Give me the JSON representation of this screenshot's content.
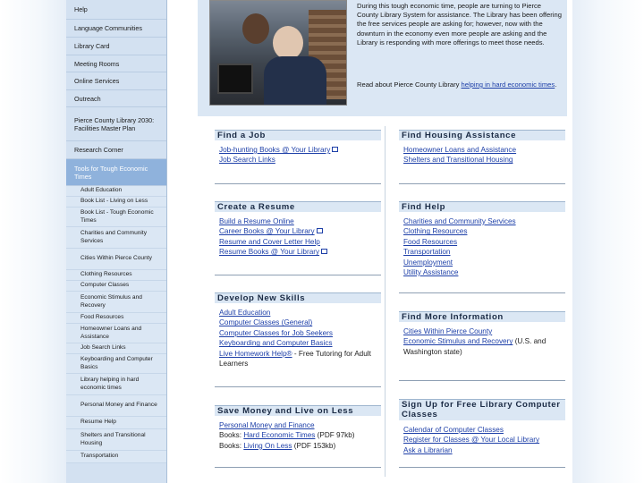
{
  "sidebar": {
    "items": [
      {
        "label": "Help"
      },
      {
        "label": "Language Communities"
      },
      {
        "label": "Library Card"
      },
      {
        "label": "Meeting Rooms"
      },
      {
        "label": "Online Services"
      },
      {
        "label": "Outreach"
      },
      {
        "label": "Pierce County Library 2030: Facilities Master Plan"
      },
      {
        "label": "Research Corner"
      },
      {
        "label": "Tools for Tough Economic Times"
      }
    ],
    "subitems": [
      {
        "label": "Adult Education"
      },
      {
        "label": "Book List - Living on Less"
      },
      {
        "label": "Book List - Tough Economic Times"
      },
      {
        "label": "Charities and Community Services"
      },
      {
        "label": "Cities Within Pierce County"
      },
      {
        "label": "Clothing Resources"
      },
      {
        "label": "Computer Classes"
      },
      {
        "label": "Economic Stimulus and Recovery"
      },
      {
        "label": "Food Resources"
      },
      {
        "label": "Homeowner Loans and Assistance"
      },
      {
        "label": "Job Search Links"
      },
      {
        "label": "Keyboarding and Computer Basics"
      },
      {
        "label": "Library helping in hard economic times"
      },
      {
        "label": "Personal Money and Finance"
      },
      {
        "label": "Resume Help"
      },
      {
        "label": "Shelters and Transitional Housing"
      },
      {
        "label": "Transportation"
      }
    ]
  },
  "intro": {
    "text": "During this tough economic time, people are turning to Pierce County Library System for assistance. The Library has been offering the free services people are asking for; however, now with the downturn in the economy even more people are asking and the Library is responding with more offerings to meet those needs.",
    "read_prefix": "Read about Pierce County Library ",
    "read_link": "helping in hard economic times",
    "read_suffix": "."
  },
  "sections": {
    "find_job": {
      "title": "Find a Job",
      "items": [
        "Job-hunting Books @ Your Library",
        "Job Search Links"
      ]
    },
    "create_resume": {
      "title": "Create a Resume",
      "items": [
        "Build a Resume Online",
        "Career Books @ Your Library",
        "Resume and Cover Letter Help",
        "Resume Books @ Your Library"
      ]
    },
    "develop_skills": {
      "title": "Develop New Skills",
      "items": [
        "Adult Education",
        "Computer Classes (General)",
        "Computer Classes for Job Seekers",
        "Keyboarding and Computer Basics"
      ],
      "live_link": "Live Homework Help®",
      "live_suffix": " - Free Tutoring for Adult Learners"
    },
    "save_money": {
      "title": "Save Money and Live on Less",
      "item1": "Personal Money and Finance",
      "books1_prefix": "Books: ",
      "books1_link": "Hard Economic Times",
      "books1_suffix": " (PDF 97kb)",
      "books2_prefix": "Books: ",
      "books2_link": "Living On Less",
      "books2_suffix": " (PDF 153kb)"
    },
    "find_housing": {
      "title": "Find Housing Assistance",
      "items": [
        "Homeowner Loans and Assistance",
        "Shelters and Transitional Housing"
      ]
    },
    "find_help": {
      "title": "Find Help",
      "items": [
        "Charities and Community Services",
        "Clothing Resources",
        "Food Resources",
        "Transportation",
        "Unemployment",
        "Utility Assistance"
      ]
    },
    "find_info": {
      "title": "Find More Information",
      "item1": "Cities Within Pierce County",
      "item2_link": "Economic Stimulus and Recovery",
      "item2_suffix": " (U.S. and Washington state)"
    },
    "signup": {
      "title": "Sign Up for Free Library Computer Classes",
      "items": [
        "Calendar of Computer Classes",
        "Register for Classes @ Your Local Library",
        "Ask a Librarian"
      ]
    }
  },
  "colors": {
    "accent": "#8fb2dc",
    "link": "#1d3fa8",
    "panel": "#dbe7f4"
  }
}
